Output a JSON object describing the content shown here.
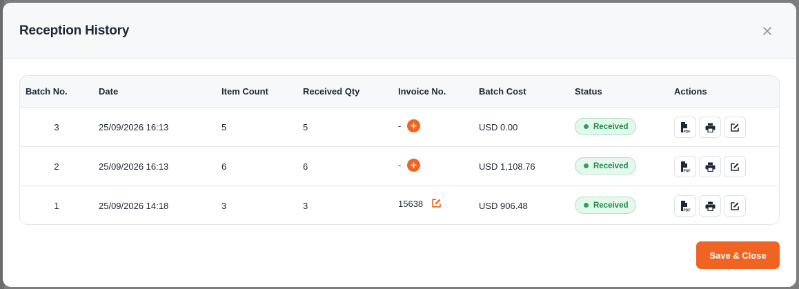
{
  "modal": {
    "title": "Reception History",
    "save_label": "Save & Close"
  },
  "colors": {
    "accent": "#ef6422",
    "status_bg": "#e6f8ee",
    "status_text": "#168a48"
  },
  "table": {
    "headers": [
      "Batch No.",
      "Date",
      "Item Count",
      "Received Qty",
      "Invoice No.",
      "Batch Cost",
      "Status",
      "Actions"
    ],
    "rows": [
      {
        "batch": "3",
        "date": "25/09/2026 16:13",
        "items": "5",
        "qty": "5",
        "invoice": "-",
        "invoice_action": "add-icon",
        "cost": "USD 0.00",
        "status": "Received"
      },
      {
        "batch": "2",
        "date": "25/09/2026 16:13",
        "items": "6",
        "qty": "6",
        "invoice": "-",
        "invoice_action": "add-icon",
        "cost": "USD 1,108.76",
        "status": "Received"
      },
      {
        "batch": "1",
        "date": "25/09/2026 14:18",
        "items": "3",
        "qty": "3",
        "invoice": "15638",
        "invoice_action": "edit-icon",
        "cost": "USD 906.48",
        "status": "Received"
      }
    ]
  },
  "icons": {
    "close": "close-icon",
    "row_actions": [
      "pdf-icon",
      "print-icon",
      "edit-icon"
    ]
  }
}
